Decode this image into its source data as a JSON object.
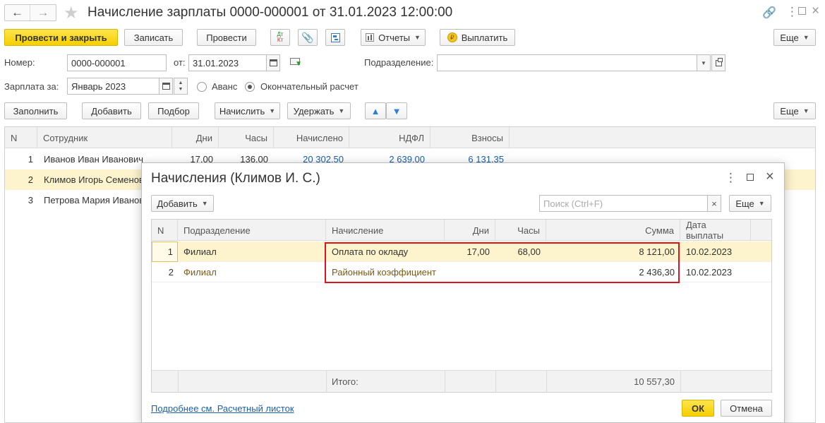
{
  "window": {
    "title": "Начисление зарплаты 0000-000001 от 31.01.2023 12:00:00"
  },
  "toolbar": {
    "post_close": "Провести и закрыть",
    "save": "Записать",
    "post": "Провести",
    "dtkt_top": "Дт",
    "dtkt_bottom": "Кт",
    "reports": "Отчеты",
    "pay": "Выплатить",
    "more": "Еще"
  },
  "form": {
    "number_label": "Номер:",
    "number_value": "0000-000001",
    "from_label": "от:",
    "date_value": "31.01.2023",
    "division_label": "Подразделение:",
    "division_value": "",
    "salary_label": "Зарплата за:",
    "salary_value": "Январь 2023",
    "radio_advance": "Аванс",
    "radio_final": "Окончательный расчет"
  },
  "actions": {
    "fill": "Заполнить",
    "add": "Добавить",
    "pick": "Подбор",
    "accrue": "Начислить",
    "withhold": "Удержать",
    "more": "Еще"
  },
  "main_table": {
    "headers": [
      "N",
      "Сотрудник",
      "Дни",
      "Часы",
      "Начислено",
      "НДФЛ",
      "Взносы"
    ],
    "rows": [
      {
        "n": "1",
        "employee": "Иванов Иван Иванович",
        "days": "17,00",
        "hours": "136,00",
        "accrued": "20 302,50",
        "ndfl": "2 639,00",
        "contrib": "6 131,35"
      },
      {
        "n": "2",
        "employee": "Климов Игорь Семенович"
      },
      {
        "n": "3",
        "employee": "Петрова Мария Ивановна"
      }
    ]
  },
  "dialog": {
    "title": "Начисления (Климов И. С.)",
    "add": "Добавить",
    "search_placeholder": "Поиск (Ctrl+F)",
    "clear": "×",
    "more": "Еще",
    "headers": [
      "N",
      "Подразделение",
      "Начисление",
      "Дни",
      "Часы",
      "Сумма",
      "Дата выплаты"
    ],
    "rows": [
      {
        "n": "1",
        "division": "Филиал",
        "accrual": "Оплата по окладу",
        "days": "17,00",
        "hours": "68,00",
        "sum": "8 121,00",
        "pay_date": "10.02.2023"
      },
      {
        "n": "2",
        "division": "Филиал",
        "accrual": "Районный коэффициент",
        "days": "",
        "hours": "",
        "sum": "2 436,30",
        "pay_date": "10.02.2023"
      }
    ],
    "total_label": "Итого:",
    "total_sum": "10 557,30",
    "payslip_link": "Подробнее см. Расчетный листок",
    "ok": "ОК",
    "cancel": "Отмена"
  },
  "colors": {
    "accent_yellow": "#f5cf00",
    "selected_row": "#fdf3cc",
    "highlight_border": "#d9161f",
    "link": "#1b5fa8"
  }
}
